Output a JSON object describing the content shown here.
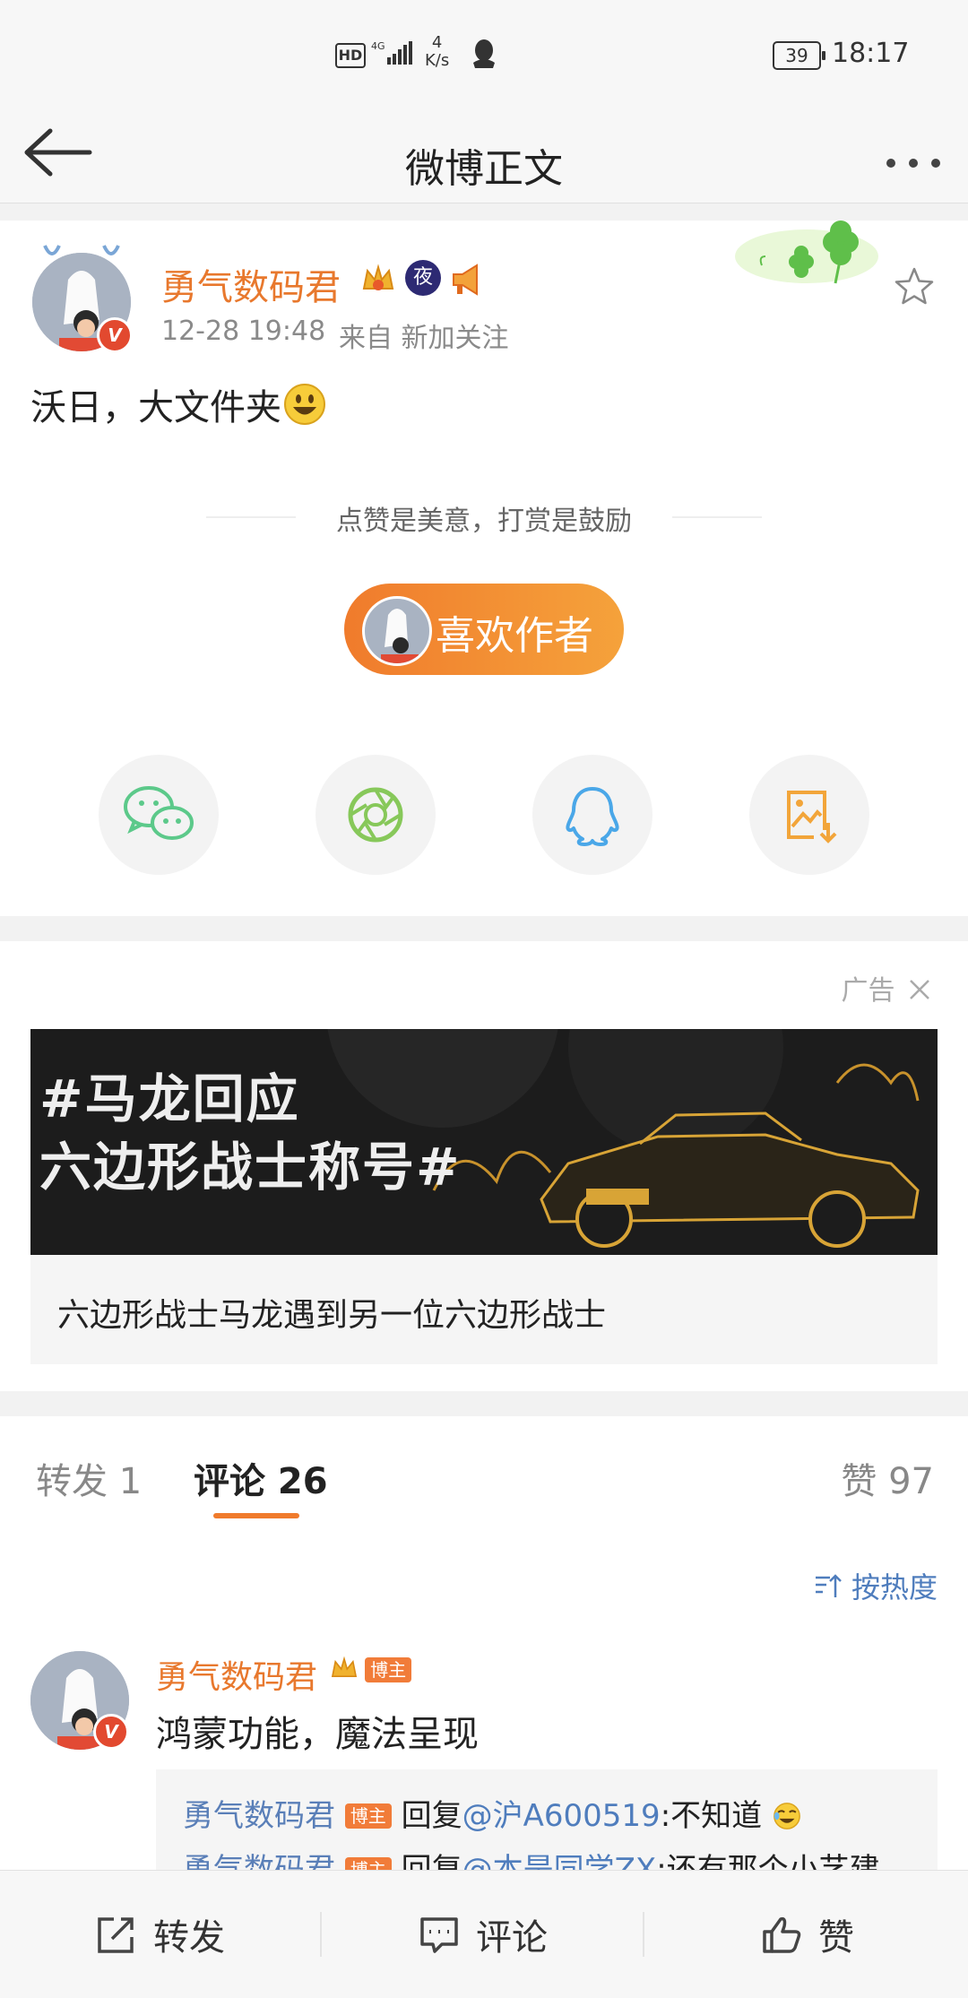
{
  "status_bar": {
    "hd": "HD",
    "network": "4G",
    "speed_value": "4",
    "speed_unit": "K/s",
    "battery": "39",
    "time": "18:17"
  },
  "nav": {
    "title": "微博正文"
  },
  "post": {
    "author": "勇气数码君",
    "badge_night": "夜",
    "date": "12-28 19:48",
    "source": "来自 新加关注",
    "content": "沃日，大文件夹",
    "reward_tip": "点赞是美意，打赏是鼓励",
    "like_author_label": "喜欢作者"
  },
  "ad": {
    "label": "广告",
    "headline_line1": "#马龙回应",
    "headline_line2": "六边形战士称号#",
    "caption": "六边形战士马龙遇到另一位六边形战士"
  },
  "tabs": {
    "repost": "转发 1",
    "comment": "评论 26",
    "like": "赞 97"
  },
  "comments": {
    "sort_label": "按热度",
    "items": [
      {
        "author": "勇气数码君",
        "role": "博主",
        "text": "鸿蒙功能，魔法呈现",
        "replies": [
          {
            "author": "勇气数码君",
            "role": "博主",
            "verb": "回复",
            "mention": "@沪A600519",
            "text": ":不知道"
          },
          {
            "author": "勇气数码君",
            "role": "博主",
            "verb": "回复",
            "mention": "@本是同学ZX",
            "text": ":还有那个小艺建"
          }
        ]
      }
    ]
  },
  "bottom_bar": {
    "repost": "转发",
    "comment": "评论",
    "like": "赞"
  },
  "colors": {
    "accent": "#f07b2c",
    "author": "#e8782d",
    "link": "#4f7dbd"
  }
}
